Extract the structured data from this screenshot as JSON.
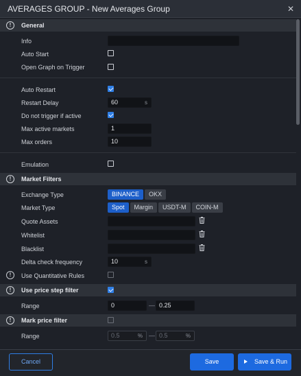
{
  "window": {
    "title": "AVERAGES GROUP - New Averages Group",
    "close_glyph": "✕"
  },
  "sections": {
    "general": {
      "label": "General"
    },
    "market_filters": {
      "label": "Market Filters"
    },
    "use_price_step": {
      "label": "Use price step filter",
      "checked": true
    },
    "mark_price": {
      "label": "Mark price filter",
      "checked": false
    }
  },
  "general": {
    "info": {
      "label": "Info",
      "value": ""
    },
    "auto_start": {
      "label": "Auto Start",
      "checked": false
    },
    "open_graph": {
      "label": "Open Graph on Trigger",
      "checked": false
    },
    "auto_restart": {
      "label": "Auto Restart",
      "checked": true
    },
    "restart_delay": {
      "label": "Restart Delay",
      "value": "60",
      "unit": "s"
    },
    "no_trigger_active": {
      "label": "Do not trigger if active",
      "checked": true
    },
    "max_active_markets": {
      "label": "Max active markets",
      "value": "1"
    },
    "max_orders": {
      "label": "Max orders",
      "value": "10"
    },
    "emulation": {
      "label": "Emulation",
      "checked": false
    }
  },
  "market_filters": {
    "exchange_type": {
      "label": "Exchange Type",
      "options": [
        "BINANCE",
        "OKX"
      ],
      "selected": "BINANCE"
    },
    "market_type": {
      "label": "Market Type",
      "options": [
        "Spot",
        "Margin",
        "USDT-M",
        "COIN-M"
      ],
      "selected": "Spot"
    },
    "quote_assets": {
      "label": "Quote Assets",
      "value": ""
    },
    "whitelist": {
      "label": "Whitelist",
      "value": ""
    },
    "blacklist": {
      "label": "Blacklist",
      "value": ""
    },
    "delta_check": {
      "label": "Delta check frequency",
      "value": "10",
      "unit": "s"
    },
    "use_quant_rules": {
      "label": "Use Quantitative Rules",
      "checked": false
    }
  },
  "price_step": {
    "range": {
      "label": "Range",
      "from": "0",
      "separator": "—",
      "to": "0.25"
    }
  },
  "mark_price": {
    "range": {
      "label": "Range",
      "from": "0.5",
      "from_unit": "%",
      "separator": "—",
      "to": "0.5",
      "to_unit": "%"
    }
  },
  "footer": {
    "cancel": "Cancel",
    "save": "Save",
    "save_run": "Save & Run"
  },
  "colors": {
    "accent": "#1d6ae0",
    "background": "#1e2128",
    "section": "#2e3239"
  }
}
